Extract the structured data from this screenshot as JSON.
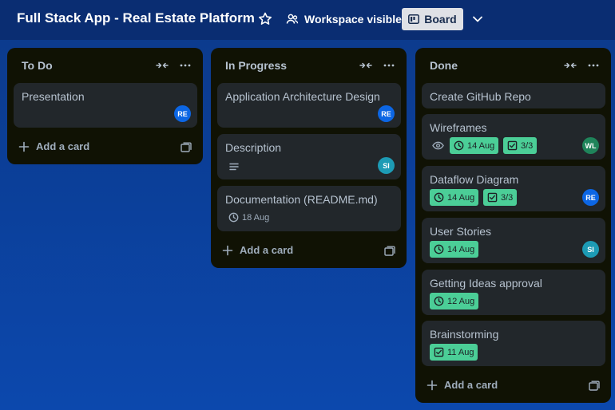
{
  "header": {
    "board_title": "Full Stack App - Real Estate Platform",
    "visibility_label": "Workspace visible",
    "view_label": "Board"
  },
  "lists": [
    {
      "title": "To Do",
      "add_card_label": "Add a card",
      "cards": [
        {
          "title": "Presentation",
          "member": "RE"
        }
      ]
    },
    {
      "title": "In Progress",
      "add_card_label": "Add a card",
      "cards": [
        {
          "title": "Application Architecture Design",
          "member": "RE"
        },
        {
          "title": "Description",
          "member": "SI",
          "icons": [
            "description-icon"
          ]
        },
        {
          "title": "Documentation (README.md)",
          "due": "18 Aug"
        }
      ]
    },
    {
      "title": "Done",
      "add_card_label": "Add a card",
      "cards": [
        {
          "title": "Create GitHub Repo"
        },
        {
          "title": "Wireframes",
          "due": "14 Aug",
          "checklist": "3/3",
          "member": "WL",
          "icons": [
            "watch-icon"
          ]
        },
        {
          "title": "Dataflow Diagram",
          "due": "14 Aug",
          "checklist": "3/3",
          "member": "RE"
        },
        {
          "title": "User Stories",
          "due": "14 Aug",
          "member": "SI"
        },
        {
          "title": "Getting Ideas approval",
          "due": "12 Aug"
        },
        {
          "title": "Brainstorming",
          "due": "11 Aug"
        }
      ]
    }
  ],
  "members": {
    "RE": {
      "initials": "RE",
      "color": "#0c66e4"
    },
    "SI": {
      "initials": "SI",
      "color": "#1d9bb5"
    },
    "WL": {
      "initials": "WL",
      "color": "#1f845a"
    }
  },
  "colors": {
    "badge_complete": "#4bce97",
    "list_bg": "#101204",
    "card_bg": "#22272b"
  }
}
